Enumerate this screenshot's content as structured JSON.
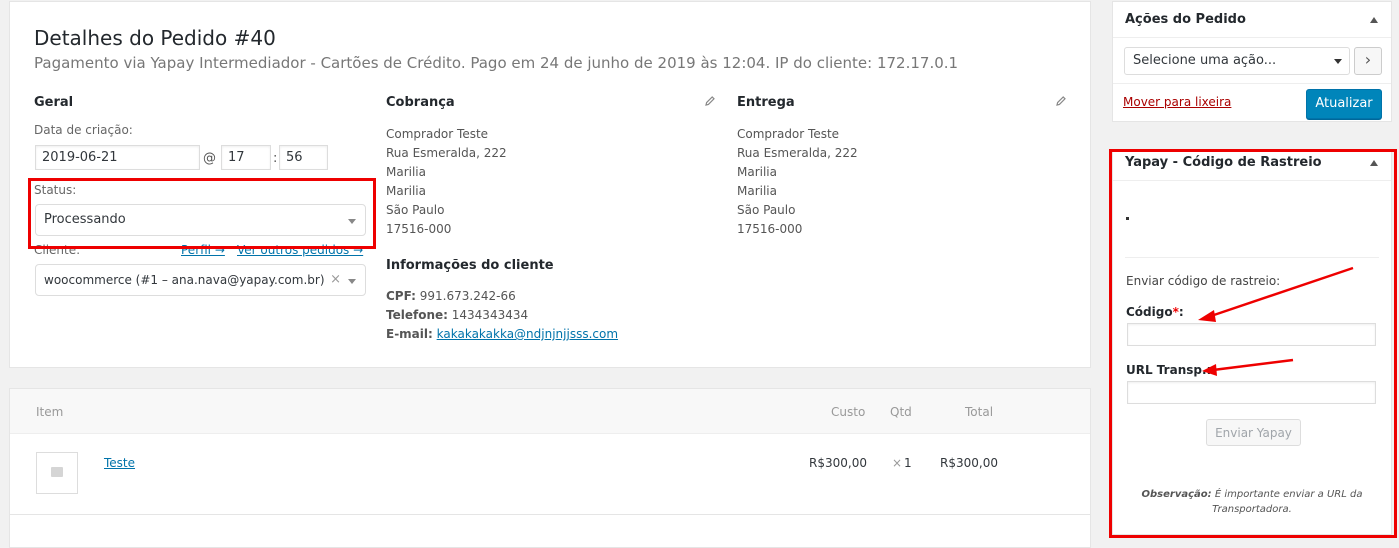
{
  "order": {
    "title": "Detalhes do Pedido #40",
    "subtitle": "Pagamento via Yapay Intermediador - Cartões de Crédito. Pago em 24 de junho de 2019 às 12:04. IP do cliente: 172.17.0.1",
    "general": {
      "heading": "Geral",
      "date_label": "Data de criação:",
      "date": "2019-06-21",
      "at": "@",
      "hour": "17",
      "colon": ":",
      "minute": "56",
      "status_label": "Status:",
      "status": "Processando",
      "customer_label": "Cliente:",
      "profile_link": "Perfil →",
      "other_orders_link": "Ver outros pedidos →",
      "customer": "woocommerce (#1 – ana.nava@yapay.com.br)",
      "clear": "×"
    },
    "billing": {
      "heading": "Cobrança",
      "lines": [
        "Comprador Teste",
        "Rua Esmeralda, 222",
        "Marilia",
        "Marilia",
        "São Paulo",
        "17516-000"
      ],
      "customer_info_heading": "Informações do cliente",
      "cpf_label": "CPF:",
      "cpf": "991.673.242-66",
      "phone_label": "Telefone:",
      "phone": "1434343434",
      "email_label": "E-mail:",
      "email": "kakakakakka@ndjnjnjjsss.com"
    },
    "shipping": {
      "heading": "Entrega",
      "lines": [
        "Comprador Teste",
        "Rua Esmeralda, 222",
        "Marilia",
        "Marilia",
        "São Paulo",
        "17516-000"
      ]
    }
  },
  "items": {
    "columns": {
      "item": "Item",
      "cost": "Custo",
      "qty": "Qtd",
      "total": "Total"
    },
    "rows": [
      {
        "name": "Teste",
        "cost": "R$300,00",
        "qty_x": "×",
        "qty": "1",
        "total": "R$300,00"
      }
    ]
  },
  "actions": {
    "heading": "Ações do Pedido",
    "select": "Selecione uma ação...",
    "go": "›",
    "trash": "Mover para lixeira",
    "update": "Atualizar"
  },
  "tracking": {
    "heading": "Yapay - Código de Rastreio",
    "send_label": "Enviar código de rastreio:",
    "code_label": "Código",
    "required": "*",
    "code_colon": ":",
    "code_value": "",
    "url_label": "URL Transp.:",
    "url_value": "",
    "submit": "Enviar Yapay",
    "note_bold": "Observação:",
    "note": "É importante enviar a URL da Transportadora."
  },
  "colors": {
    "highlight": "#e00000",
    "accent": "#0085ba",
    "link": "#0073aa"
  },
  "icons": [
    "edit-pencil-icon",
    "dropdown-caret-icon",
    "collapse-arrow-icon",
    "image-placeholder-icon",
    "red-arrow-annotation"
  ]
}
